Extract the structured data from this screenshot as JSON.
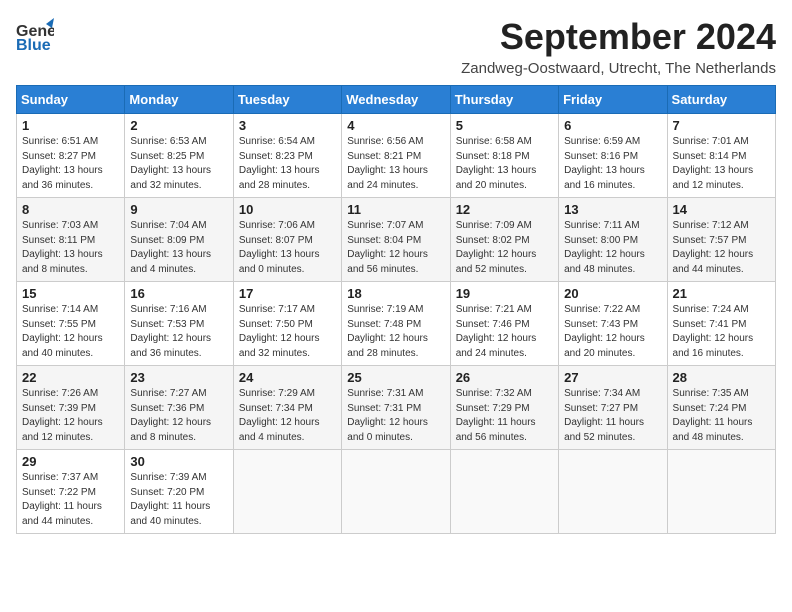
{
  "header": {
    "logo_general": "General",
    "logo_blue": "Blue",
    "title": "September 2024",
    "subtitle": "Zandweg-Oostwaard, Utrecht, The Netherlands"
  },
  "days_of_week": [
    "Sunday",
    "Monday",
    "Tuesday",
    "Wednesday",
    "Thursday",
    "Friday",
    "Saturday"
  ],
  "weeks": [
    [
      {
        "day": "1",
        "sunrise": "6:51 AM",
        "sunset": "8:27 PM",
        "daylight": "13 hours and 36 minutes."
      },
      {
        "day": "2",
        "sunrise": "6:53 AM",
        "sunset": "8:25 PM",
        "daylight": "13 hours and 32 minutes."
      },
      {
        "day": "3",
        "sunrise": "6:54 AM",
        "sunset": "8:23 PM",
        "daylight": "13 hours and 28 minutes."
      },
      {
        "day": "4",
        "sunrise": "6:56 AM",
        "sunset": "8:21 PM",
        "daylight": "13 hours and 24 minutes."
      },
      {
        "day": "5",
        "sunrise": "6:58 AM",
        "sunset": "8:18 PM",
        "daylight": "13 hours and 20 minutes."
      },
      {
        "day": "6",
        "sunrise": "6:59 AM",
        "sunset": "8:16 PM",
        "daylight": "13 hours and 16 minutes."
      },
      {
        "day": "7",
        "sunrise": "7:01 AM",
        "sunset": "8:14 PM",
        "daylight": "13 hours and 12 minutes."
      }
    ],
    [
      {
        "day": "8",
        "sunrise": "7:03 AM",
        "sunset": "8:11 PM",
        "daylight": "13 hours and 8 minutes."
      },
      {
        "day": "9",
        "sunrise": "7:04 AM",
        "sunset": "8:09 PM",
        "daylight": "13 hours and 4 minutes."
      },
      {
        "day": "10",
        "sunrise": "7:06 AM",
        "sunset": "8:07 PM",
        "daylight": "13 hours and 0 minutes."
      },
      {
        "day": "11",
        "sunrise": "7:07 AM",
        "sunset": "8:04 PM",
        "daylight": "12 hours and 56 minutes."
      },
      {
        "day": "12",
        "sunrise": "7:09 AM",
        "sunset": "8:02 PM",
        "daylight": "12 hours and 52 minutes."
      },
      {
        "day": "13",
        "sunrise": "7:11 AM",
        "sunset": "8:00 PM",
        "daylight": "12 hours and 48 minutes."
      },
      {
        "day": "14",
        "sunrise": "7:12 AM",
        "sunset": "7:57 PM",
        "daylight": "12 hours and 44 minutes."
      }
    ],
    [
      {
        "day": "15",
        "sunrise": "7:14 AM",
        "sunset": "7:55 PM",
        "daylight": "12 hours and 40 minutes."
      },
      {
        "day": "16",
        "sunrise": "7:16 AM",
        "sunset": "7:53 PM",
        "daylight": "12 hours and 36 minutes."
      },
      {
        "day": "17",
        "sunrise": "7:17 AM",
        "sunset": "7:50 PM",
        "daylight": "12 hours and 32 minutes."
      },
      {
        "day": "18",
        "sunrise": "7:19 AM",
        "sunset": "7:48 PM",
        "daylight": "12 hours and 28 minutes."
      },
      {
        "day": "19",
        "sunrise": "7:21 AM",
        "sunset": "7:46 PM",
        "daylight": "12 hours and 24 minutes."
      },
      {
        "day": "20",
        "sunrise": "7:22 AM",
        "sunset": "7:43 PM",
        "daylight": "12 hours and 20 minutes."
      },
      {
        "day": "21",
        "sunrise": "7:24 AM",
        "sunset": "7:41 PM",
        "daylight": "12 hours and 16 minutes."
      }
    ],
    [
      {
        "day": "22",
        "sunrise": "7:26 AM",
        "sunset": "7:39 PM",
        "daylight": "12 hours and 12 minutes."
      },
      {
        "day": "23",
        "sunrise": "7:27 AM",
        "sunset": "7:36 PM",
        "daylight": "12 hours and 8 minutes."
      },
      {
        "day": "24",
        "sunrise": "7:29 AM",
        "sunset": "7:34 PM",
        "daylight": "12 hours and 4 minutes."
      },
      {
        "day": "25",
        "sunrise": "7:31 AM",
        "sunset": "7:31 PM",
        "daylight": "12 hours and 0 minutes."
      },
      {
        "day": "26",
        "sunrise": "7:32 AM",
        "sunset": "7:29 PM",
        "daylight": "11 hours and 56 minutes."
      },
      {
        "day": "27",
        "sunrise": "7:34 AM",
        "sunset": "7:27 PM",
        "daylight": "11 hours and 52 minutes."
      },
      {
        "day": "28",
        "sunrise": "7:35 AM",
        "sunset": "7:24 PM",
        "daylight": "11 hours and 48 minutes."
      }
    ],
    [
      {
        "day": "29",
        "sunrise": "7:37 AM",
        "sunset": "7:22 PM",
        "daylight": "11 hours and 44 minutes."
      },
      {
        "day": "30",
        "sunrise": "7:39 AM",
        "sunset": "7:20 PM",
        "daylight": "11 hours and 40 minutes."
      },
      null,
      null,
      null,
      null,
      null
    ]
  ]
}
